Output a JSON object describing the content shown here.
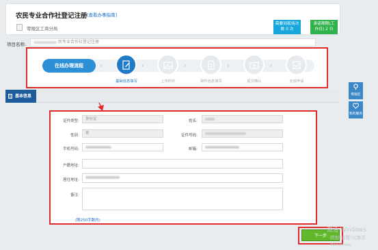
{
  "header": {
    "title": "农民专业合作社登记注册",
    "guide_link": "[查看办事指南]",
    "department": "零陵区工商分局",
    "badges": [
      {
        "line1": "需要到现场次",
        "line2": "数 0 次"
      },
      {
        "line1": "承诺期限(工",
        "line2": "作日) 2 日"
      }
    ]
  },
  "project": {
    "label": "项目名称:",
    "value_suffix": "民专业合作社登记注册"
  },
  "steps": {
    "head": "在线办理流程",
    "chevron": "›",
    "items": [
      {
        "label": "基础信息填写",
        "icon": "edit-form-icon",
        "active": true
      },
      {
        "label": "上传附件",
        "icon": "image-upload-icon",
        "active": false
      },
      {
        "label": "取件信息填写",
        "icon": "document-icon",
        "active": false
      },
      {
        "label": "提交确认",
        "icon": "folder-upload-icon",
        "active": false
      },
      {
        "label": "完成申请",
        "icon": "checkbox-icon",
        "active": false
      }
    ]
  },
  "side": {
    "guide": "零陵区",
    "service": "我的服务"
  },
  "section": {
    "tab": "基本信息"
  },
  "form": {
    "id_type_label": "证件类型:",
    "id_type_value": "身份证",
    "name_label": "姓名:",
    "gender_label": "性别:",
    "gender_value": "男",
    "id_number_label": "证件号码:",
    "phone_label": "手机号码:",
    "email_label": "邮箱:",
    "household_label": "户籍地址:",
    "residence_label": "居住地址:",
    "remark_label": "备注:",
    "limit_note": "(限250字数内)"
  },
  "actions": {
    "next": "下一步"
  },
  "watermark": {
    "line1": "激活 Windows",
    "line2": "转到\"设置\"以激活 Windows。"
  },
  "colors": {
    "accent": "#2d8fd6",
    "active_step": "#1f7ac7",
    "next_green": "#62b82b",
    "highlight_red": "#e22b2b"
  }
}
